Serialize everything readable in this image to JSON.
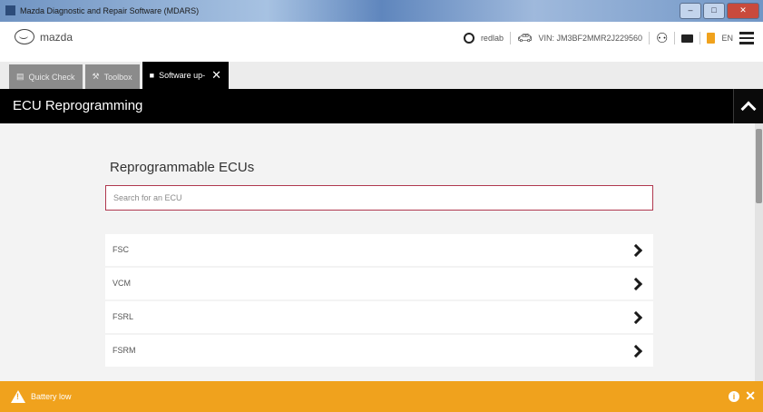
{
  "window": {
    "title": "Mazda Diagnostic and Repair Software (MDARS)",
    "minimize": "–",
    "maximize": "□",
    "close": "✕"
  },
  "header": {
    "brand": "mazda",
    "user": "redlab",
    "vin": "VIN: JM3BF2MMR2J229560",
    "language": "EN"
  },
  "tabs": [
    {
      "label": "Quick Check"
    },
    {
      "label": "Toolbox"
    },
    {
      "label": "Software up-"
    }
  ],
  "section": {
    "title": "ECU Reprogramming"
  },
  "panel": {
    "title": "Reprogrammable ECUs",
    "search_placeholder": "Search for an ECU"
  },
  "ecus": [
    {
      "label": "FSC"
    },
    {
      "label": "VCM"
    },
    {
      "label": "FSRL"
    },
    {
      "label": "FSRM"
    }
  ],
  "status": {
    "message": "Battery low",
    "color": "#f0a21d"
  }
}
